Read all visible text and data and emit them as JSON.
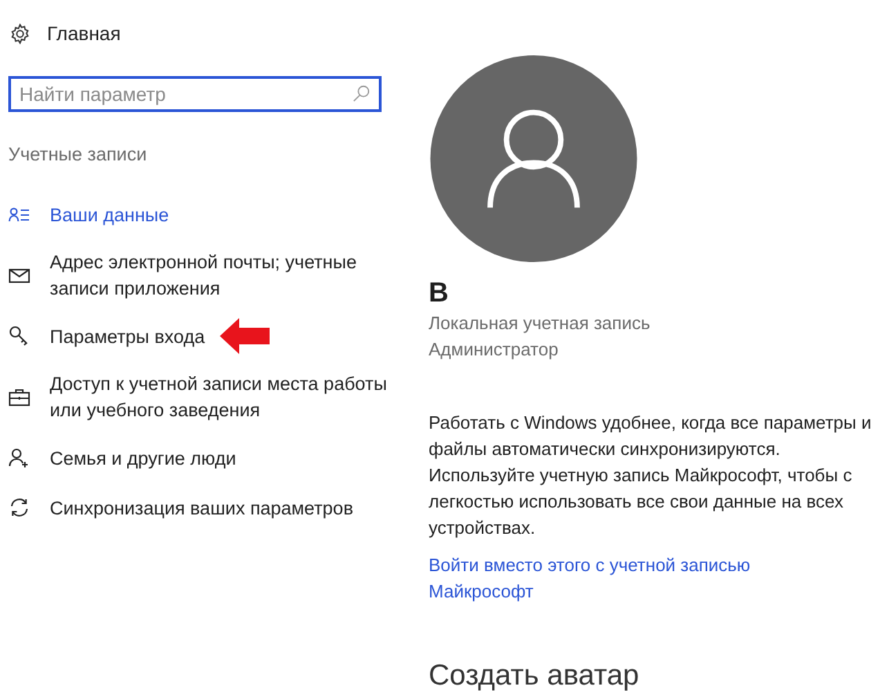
{
  "home": {
    "label": "Главная"
  },
  "search": {
    "placeholder": "Найти параметр"
  },
  "section_title": "Учетные записи",
  "nav_items": [
    {
      "kind": "person-list",
      "label": "Ваши данные",
      "selected": true
    },
    {
      "kind": "mail",
      "label": "Адрес электронной почты; учетные записи приложения",
      "selected": false
    },
    {
      "kind": "key",
      "label": "Параметры входа",
      "selected": false
    },
    {
      "kind": "briefcase",
      "label": "Доступ к учетной записи места работы или учебного заведения",
      "selected": false
    },
    {
      "kind": "person-add",
      "label": "Семья и другие люди",
      "selected": false
    },
    {
      "kind": "sync",
      "label": "Синхронизация ваших параметров",
      "selected": false
    }
  ],
  "account": {
    "name": "B",
    "type": "Локальная учетная запись",
    "role": "Администратор"
  },
  "sync_message": "Работать с Windows удобнее, когда все параметры и файлы автоматически синхронизируются. Используйте учетную запись Майкрософт, чтобы с легкостью использовать все свои данные на всех устройствах.",
  "signin_link": "Войти вместо этого с учетной записью Майкрософт",
  "avatar_heading": "Создать аватар"
}
